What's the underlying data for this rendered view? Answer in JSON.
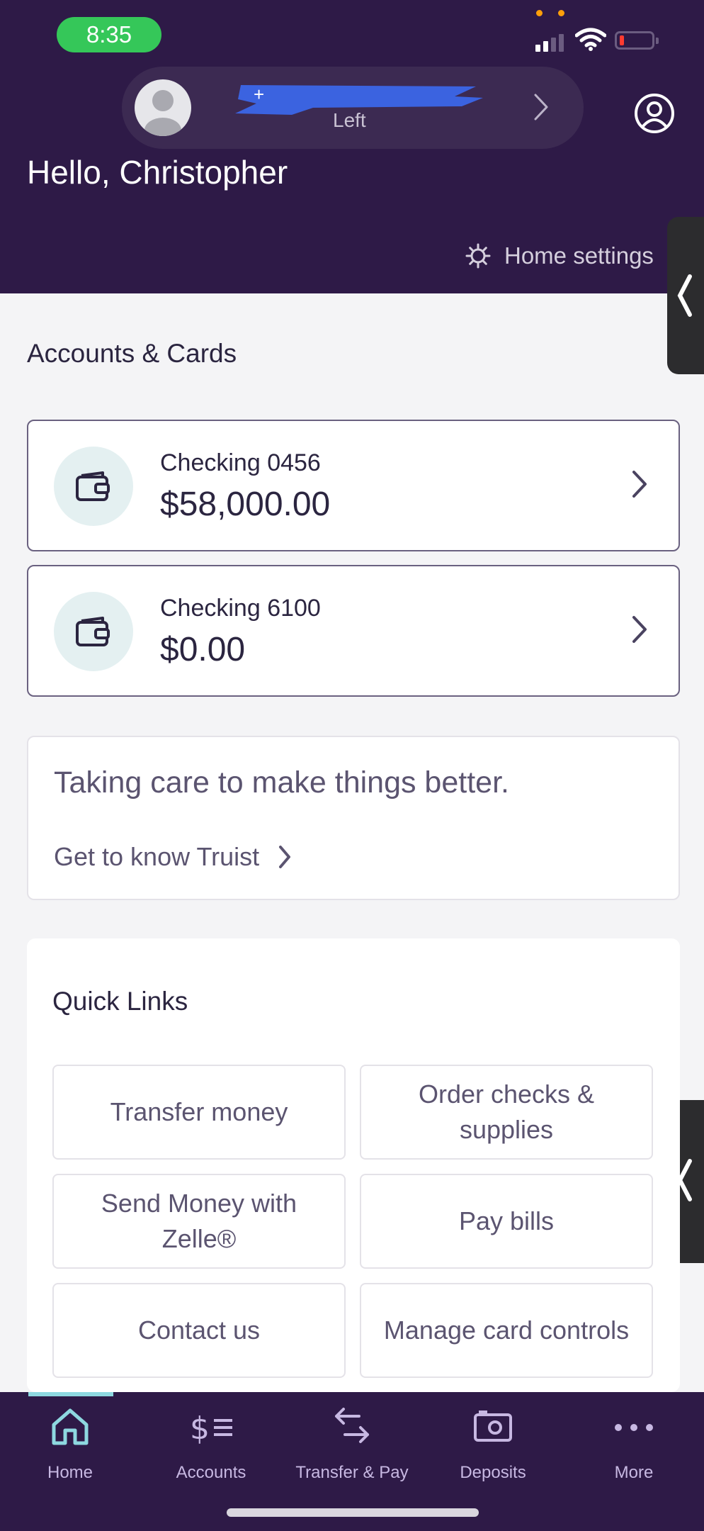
{
  "status_bar": {
    "time": "8:35"
  },
  "account_switcher": {
    "prefix": "+",
    "subtitle": "Left"
  },
  "greeting": "Hello, Christopher",
  "home_settings_label": "Home settings",
  "accounts_section_title": "Accounts & Cards",
  "accounts": [
    {
      "name": "Checking 0456",
      "balance": "$58,000.00"
    },
    {
      "name": "Checking 6100",
      "balance": "$0.00"
    }
  ],
  "promo": {
    "text": "Taking care to make things better.",
    "link": "Get to know Truist"
  },
  "quick_links": {
    "title": "Quick Links",
    "items": [
      {
        "label": "Transfer money"
      },
      {
        "label": "Order checks & supplies"
      },
      {
        "label": "Send Money with Zelle®"
      },
      {
        "label": "Pay bills"
      },
      {
        "label": "Contact us"
      },
      {
        "label": "Manage card controls"
      }
    ]
  },
  "tabs": [
    {
      "label": "Home",
      "icon": "home-icon",
      "active": true
    },
    {
      "label": "Accounts",
      "icon": "dollar-list-icon"
    },
    {
      "label": "Transfer & Pay",
      "icon": "transfer-arrows-icon"
    },
    {
      "label": "Deposits",
      "icon": "camera-check-icon"
    },
    {
      "label": "More",
      "icon": "more-dots-icon"
    }
  ],
  "colors": {
    "header": "#2e1a47",
    "accent": "#8ed8e0",
    "icon_bg": "#e4f0f1",
    "time_pill": "#35c759"
  }
}
